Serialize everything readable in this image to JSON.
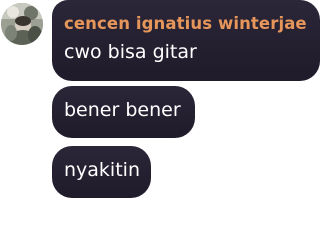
{
  "chat": {
    "sender_name": "cencen ignatius winterjae",
    "avatar_icon": "user-avatar-photo",
    "sender_color": "#e7965b",
    "bubble_color": "#231f2f",
    "messages": [
      {
        "text": "cwo bisa gitar"
      },
      {
        "text": "bener bener"
      },
      {
        "text": "nyakitin"
      }
    ]
  }
}
